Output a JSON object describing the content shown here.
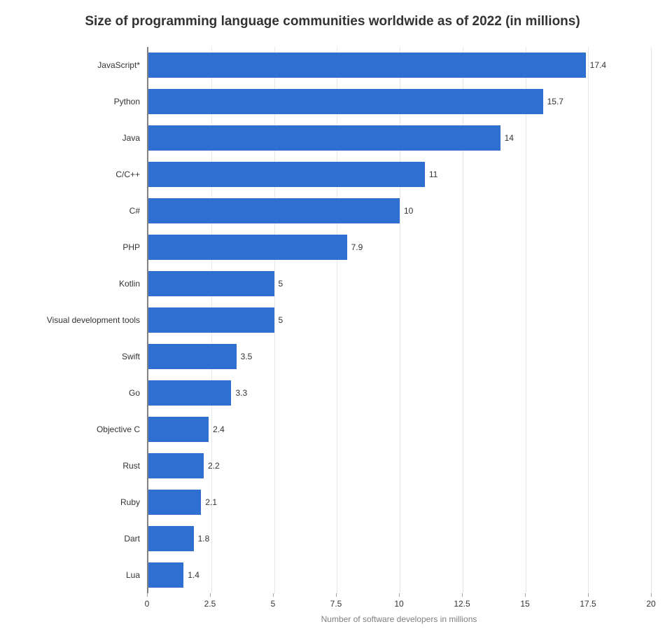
{
  "chart_data": {
    "type": "bar",
    "orientation": "horizontal",
    "title": "Size of programming language communities worldwide as of 2022 (in millions)",
    "xlabel": "Number of software developers in millions",
    "ylabel": "",
    "xlim": [
      0,
      20
    ],
    "x_ticks": [
      0,
      2.5,
      5,
      7.5,
      10,
      12.5,
      15,
      17.5,
      20
    ],
    "categories": [
      "JavaScript*",
      "Python",
      "Java",
      "C/C++",
      "C#",
      "PHP",
      "Kotlin",
      "Visual development tools",
      "Swift",
      "Go",
      "Objective C",
      "Rust",
      "Ruby",
      "Dart",
      "Lua"
    ],
    "values": [
      17.4,
      15.7,
      14,
      11,
      10,
      7.9,
      5,
      5,
      3.5,
      3.3,
      2.4,
      2.2,
      2.1,
      1.8,
      1.4
    ],
    "bar_color": "#2f6fd2"
  }
}
